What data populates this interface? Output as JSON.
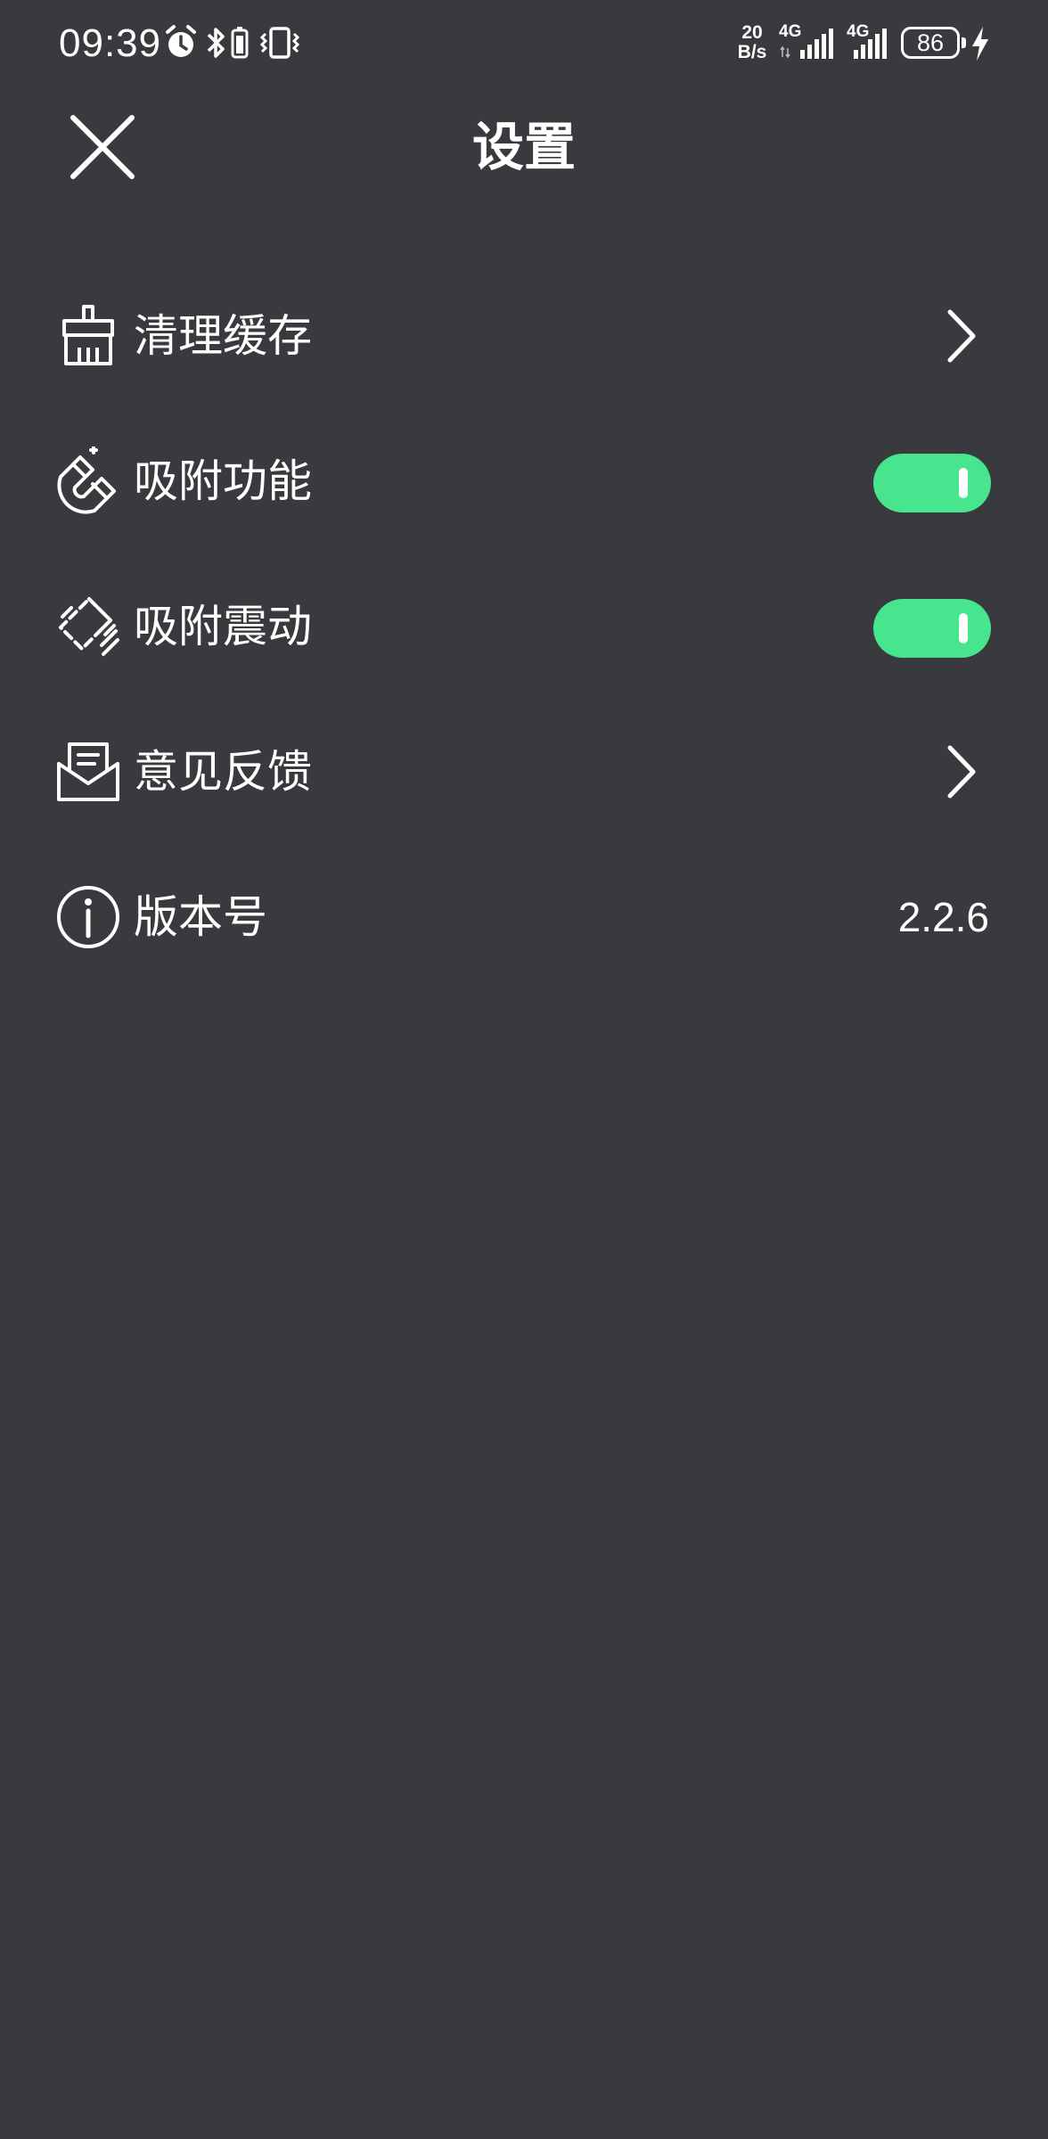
{
  "status_bar": {
    "time": "09:39",
    "net_speed_value": "20",
    "net_speed_unit": "B/s",
    "sim1_label": "4G",
    "sim2_label": "4G",
    "battery_level": "86"
  },
  "header": {
    "title": "设置"
  },
  "settings": {
    "clear_cache": {
      "label": "清理缓存",
      "icon": "broom-icon"
    },
    "snap_function": {
      "label": "吸附功能",
      "icon": "magnet-icon",
      "enabled": true
    },
    "snap_vibration": {
      "label": "吸附震动",
      "icon": "vibration-icon",
      "enabled": true
    },
    "feedback": {
      "label": "意见反馈",
      "icon": "mail-icon"
    },
    "version": {
      "label": "版本号",
      "icon": "info-icon",
      "value": "2.2.6"
    }
  },
  "colors": {
    "background": "#393a3e",
    "toggle_on": "#47e58d",
    "text": "#ffffff"
  }
}
